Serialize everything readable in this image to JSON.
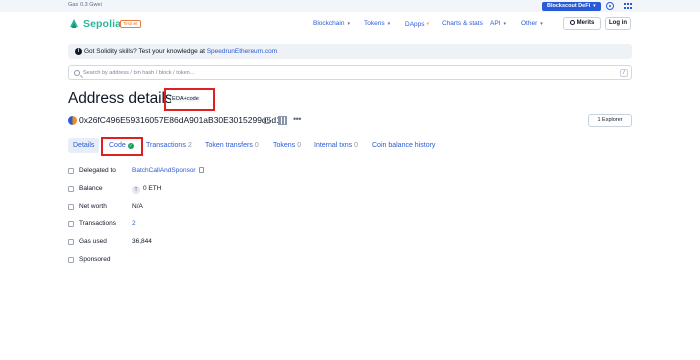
{
  "topbar": {
    "gas_label": "Gas",
    "gas_value": "0.3 Gwei",
    "defi_button": "Blockscout DeFi"
  },
  "header": {
    "logo": "Sepolia",
    "network_badge": "Testnet",
    "nav": [
      {
        "label": "Blockchain"
      },
      {
        "label": "Tokens"
      },
      {
        "label": "DApps"
      },
      {
        "label": "Charts & stats"
      },
      {
        "label": "API"
      },
      {
        "label": "Other"
      }
    ],
    "merits_button": "Merits",
    "login_button": "Log in"
  },
  "banner": {
    "text": "Got Solidity skills? Test your knowledge at ",
    "link": "SpeedrunEthereum.com"
  },
  "search": {
    "placeholder": "Search by address / txn hash / block / token...",
    "shortcut": "/"
  },
  "page": {
    "title": "Address details",
    "badge": "EOA+code",
    "address": "0x26fC496E59316057E86dA901aB30E3015299d5d1",
    "explorer_button": "1 Explorer"
  },
  "tabs": [
    {
      "label": "Details",
      "count": ""
    },
    {
      "label": "Code",
      "count": ""
    },
    {
      "label": "Transactions",
      "count": "2"
    },
    {
      "label": "Token transfers",
      "count": "0"
    },
    {
      "label": "Tokens",
      "count": "0"
    },
    {
      "label": "Internal txns",
      "count": "0"
    },
    {
      "label": "Coin balance history",
      "count": ""
    }
  ],
  "details": [
    {
      "label": "Delegated to",
      "value": "BatchCallAndSponsor"
    },
    {
      "label": "Balance",
      "value": "0 ETH"
    },
    {
      "label": "Net worth",
      "value": "N/A"
    },
    {
      "label": "Transactions",
      "value": "2"
    },
    {
      "label": "Gas used",
      "value": "36,844"
    },
    {
      "label": "Sponsored",
      "value": ""
    }
  ],
  "colors": {
    "accent": "#2a5bd7",
    "logo_green": "#2bb59a",
    "annotation_red": "#e02020",
    "verified_green": "#1a9e5c"
  }
}
